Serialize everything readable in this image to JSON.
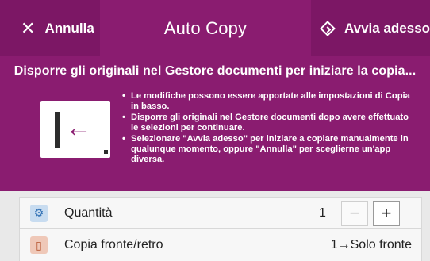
{
  "header": {
    "cancel_label": "Annulla",
    "title": "Auto Copy",
    "start_label": "Avvia adesso",
    "bg_color": "#8a1c70"
  },
  "banner": {
    "title": "Disporre gli originali nel Gestore documenti per iniziare la copia...",
    "bullets": [
      "Le modifiche possono essere apportate alle impostazioni di Copia in basso.",
      "Disporre gli originali nel Gestore documenti dopo avere effettuato le selezioni per continuare.",
      "Selezionare \"Avvia adesso\" per iniziare a copiare manualmente in qualunque momento, oppure \"Annulla\" per sceglierne un'app diversa."
    ],
    "illustration_icon": "arrow-left-icon"
  },
  "settings": {
    "quantity": {
      "label": "Quantità",
      "value": "1",
      "icon": "copies-icon"
    },
    "duplex": {
      "label": "Copia fronte/retro",
      "value": "1→Solo fronte",
      "icon": "duplex-page-icon"
    }
  }
}
